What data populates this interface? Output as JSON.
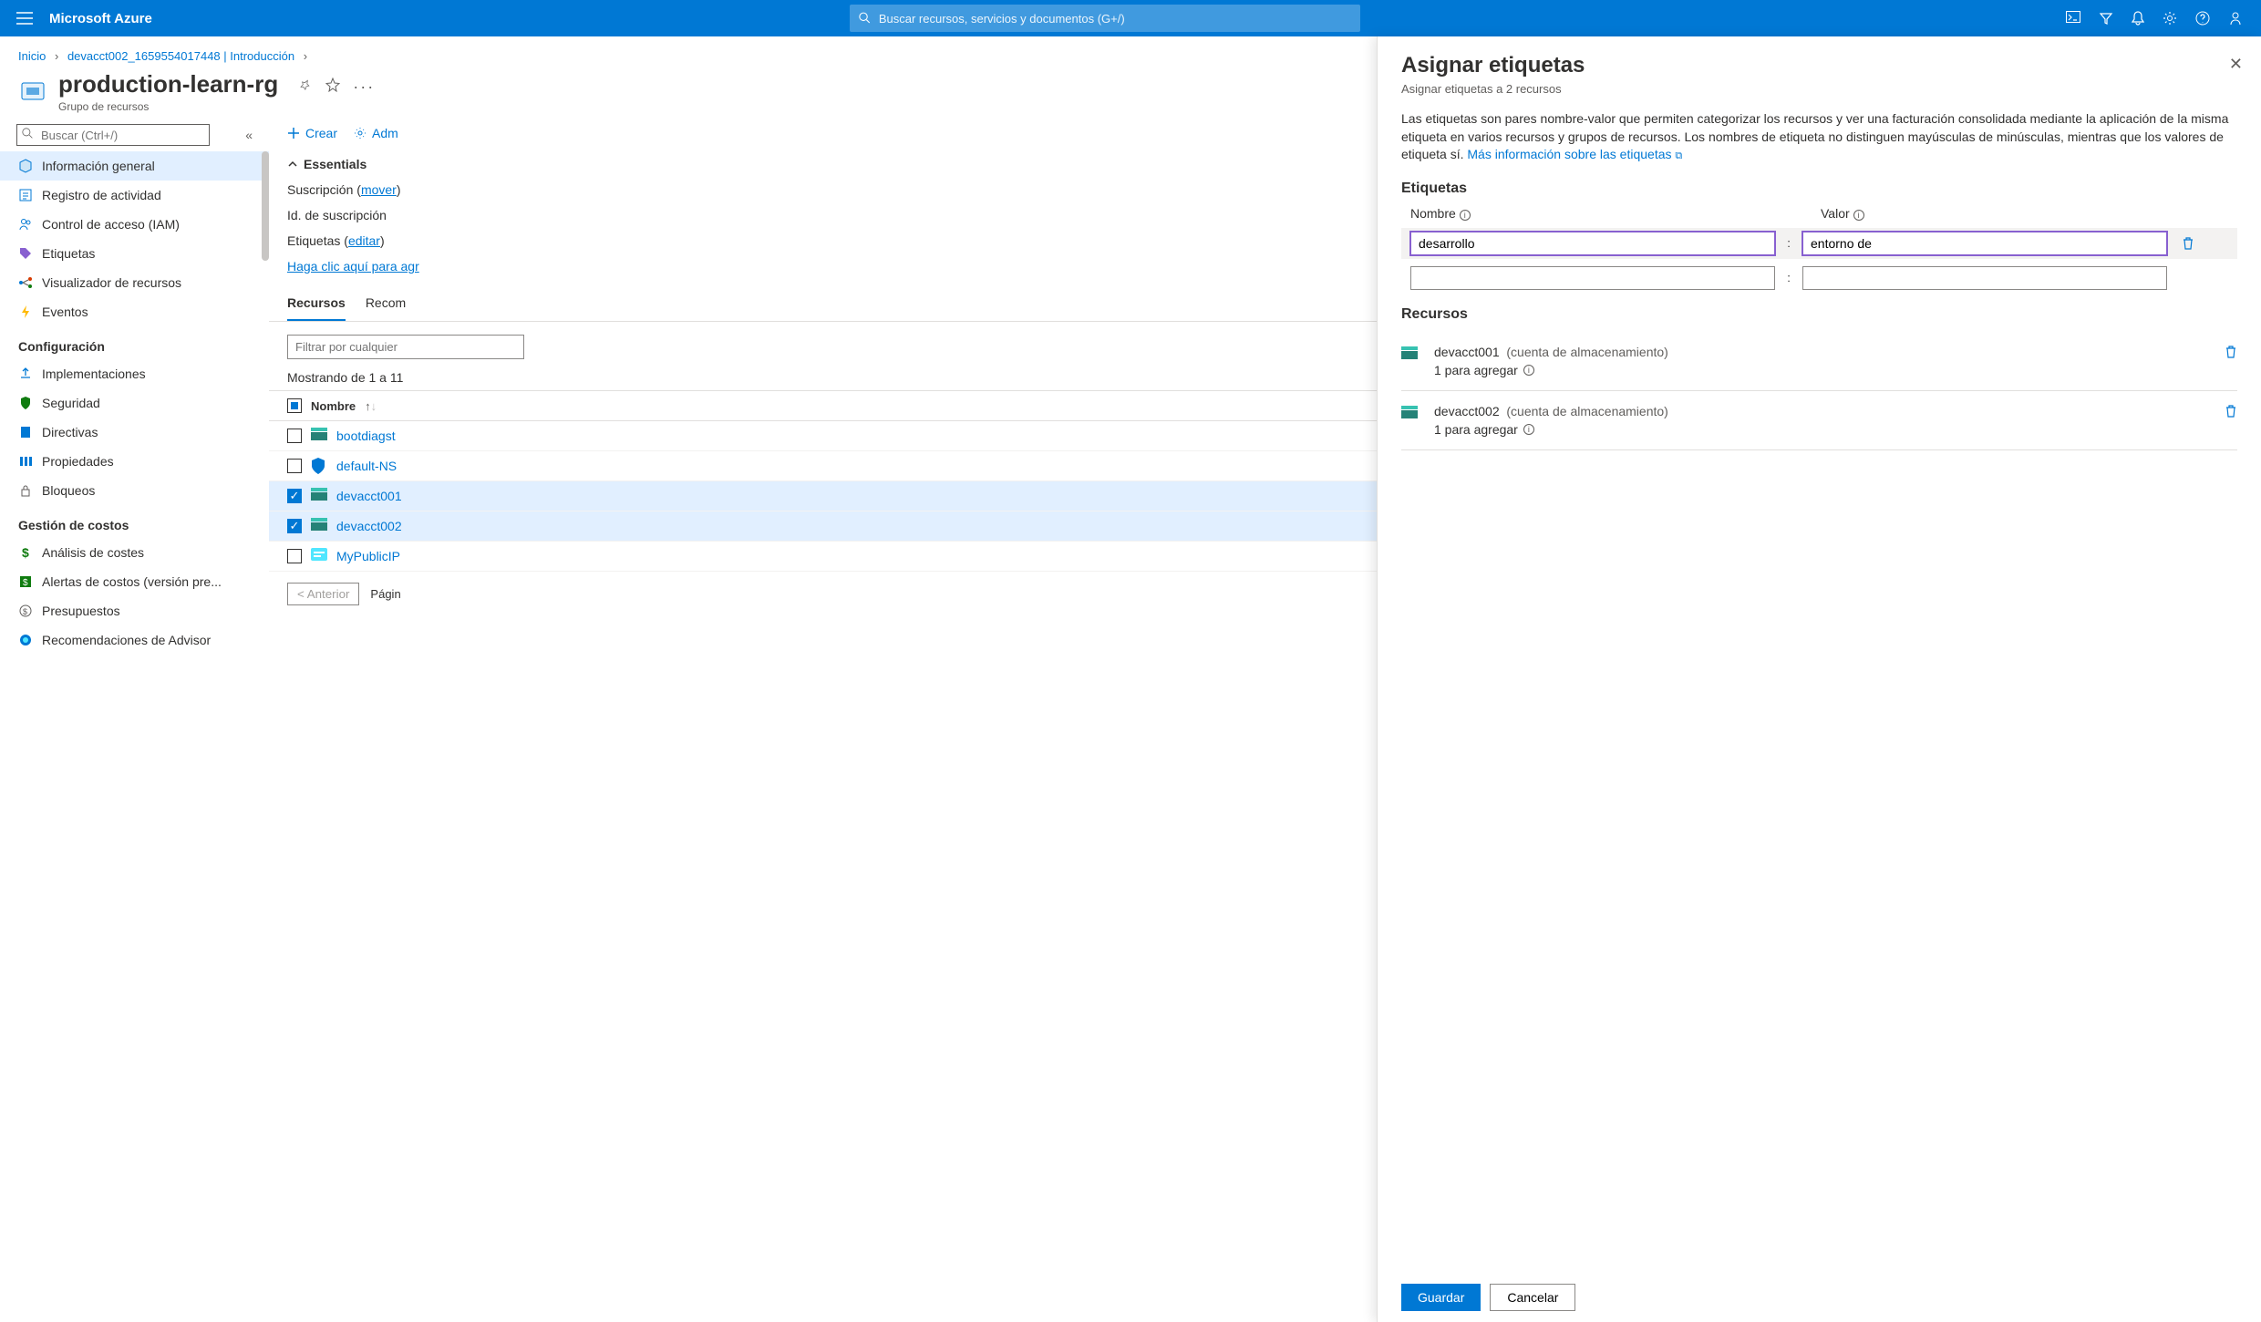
{
  "topbar": {
    "brand": "Microsoft Azure",
    "search_placeholder": "Buscar recursos, servicios y documentos (G+/)"
  },
  "breadcrumb": {
    "home": "Inicio",
    "item": "devacct002_1659554017448 | Introducción"
  },
  "header": {
    "title": "production-learn-rg",
    "subtitle": "Grupo de recursos"
  },
  "sidebar": {
    "search_placeholder": "Buscar (Ctrl+/)",
    "items": [
      {
        "label": "Información general"
      },
      {
        "label": "Registro de actividad"
      },
      {
        "label": "Control de acceso (IAM)"
      },
      {
        "label": "Etiquetas"
      },
      {
        "label": "Visualizador de recursos"
      },
      {
        "label": "Eventos"
      }
    ],
    "section_config": "Configuración",
    "config_items": [
      {
        "label": "Implementaciones"
      },
      {
        "label": "Seguridad"
      },
      {
        "label": "Directivas"
      },
      {
        "label": "Propiedades"
      },
      {
        "label": "Bloqueos"
      }
    ],
    "section_cost": "Gestión de costos",
    "cost_items": [
      {
        "label": "Análisis de costes"
      },
      {
        "label": "Alertas de costos (versión pre..."
      },
      {
        "label": "Presupuestos"
      },
      {
        "label": "Recomendaciones de Advisor"
      }
    ]
  },
  "toolbar": {
    "create": "Crear",
    "manage": "Adm"
  },
  "essentials": {
    "heading": "Essentials",
    "subscription_label": "Suscripción",
    "subscription_move": "mover",
    "sub_id_label": "Id. de suscripción",
    "tags_label": "Etiquetas",
    "tags_edit": "editar",
    "tags_add": "Haga clic aquí para agr"
  },
  "tabs": {
    "resources": "Recursos",
    "recommendations": "Recom"
  },
  "filter_placeholder": "Filtrar por cualquier",
  "showing": "Mostrando de 1 a 11",
  "table": {
    "col_name": "Nombre",
    "rows": [
      {
        "name": "bootdiagst",
        "checked": false,
        "icon": "storage"
      },
      {
        "name": "default-NS",
        "checked": false,
        "icon": "shield"
      },
      {
        "name": "devacct001",
        "checked": true,
        "icon": "storage"
      },
      {
        "name": "devacct002",
        "checked": true,
        "icon": "storage"
      },
      {
        "name": "MyPublicIP",
        "checked": false,
        "icon": "ip"
      }
    ]
  },
  "pager": {
    "prev": "< Anterior",
    "page_label": "Págin"
  },
  "panel": {
    "title": "Asignar etiquetas",
    "subtitle": "Asignar etiquetas a 2 recursos",
    "description": "Las etiquetas son pares nombre-valor que permiten categorizar los recursos y ver una facturación consolidada mediante la aplicación de la misma etiqueta en varios recursos y grupos de recursos. Los nombres de etiqueta no distinguen mayúsculas de minúsculas, mientras que los valores de etiqueta sí.",
    "learn_more": "Más información sobre las etiquetas",
    "section_tags": "Etiquetas",
    "col_name": "Nombre",
    "col_value": "Valor",
    "tag_rows": [
      {
        "name": "desarrollo",
        "value": "entorno de"
      },
      {
        "name": "",
        "value": ""
      }
    ],
    "section_resources": "Recursos",
    "resources": [
      {
        "name": "devacct001",
        "type": "(cuenta de almacenamiento)",
        "sub": "1 para agregar"
      },
      {
        "name": "devacct002",
        "type": "(cuenta de almacenamiento)",
        "sub": "1 para agregar"
      }
    ],
    "save": "Guardar",
    "cancel": "Cancelar"
  }
}
